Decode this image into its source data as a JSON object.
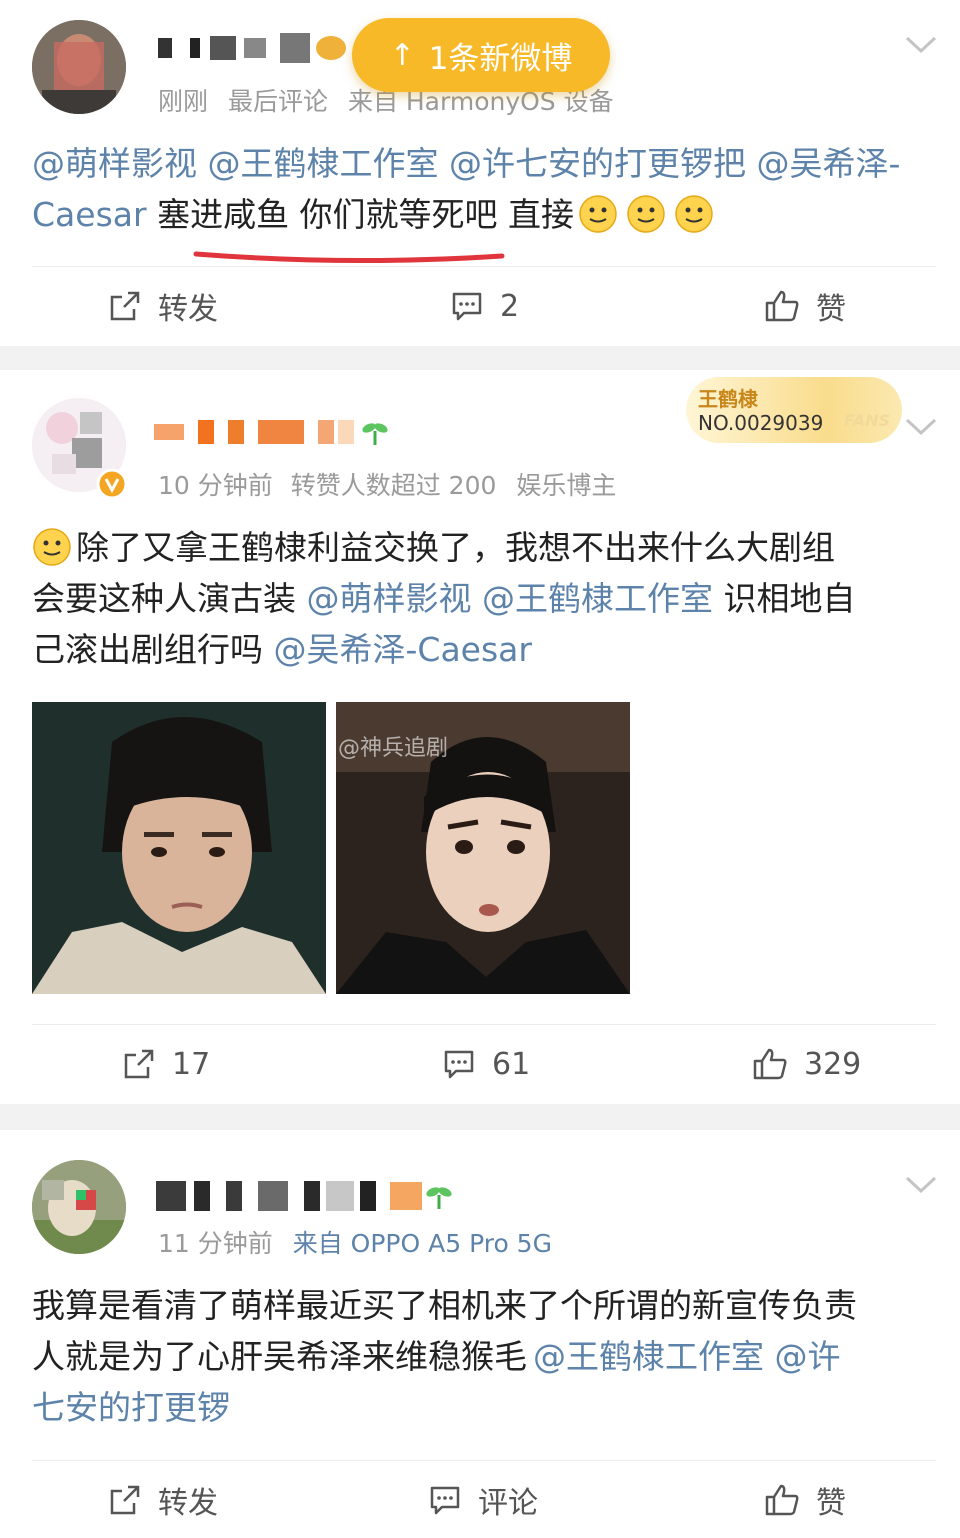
{
  "new_posts_pill": {
    "arrow": "↑",
    "label": "1条新微博"
  },
  "posts": [
    {
      "meta": {
        "time": "刚刚",
        "extra": "最后评论",
        "source": "来自 HarmonyOS 设备"
      },
      "content": {
        "mentions": [
          "@萌样影视",
          "@王鹤棣工作室",
          "@许七安的打更锣把",
          "@吴希泽-Caesar"
        ],
        "text": "塞进咸鱼 你们就等死吧 直接"
      },
      "actions": {
        "repost": "转发",
        "comment": "2",
        "like": "赞"
      }
    },
    {
      "meta": {
        "time": "10 分钟前",
        "extra": "转赞人数超过 200",
        "source": "娱乐博主"
      },
      "fans_badge": {
        "name": "王鹤棣",
        "number": "NO.0029039",
        "tag": "FANS"
      },
      "content": {
        "text1": "除了又拿王鹤棣利益交换了，我想不出来什么大剧组",
        "text2": "会要这种人演古装",
        "mention1": "@萌样影视",
        "mention2": "@王鹤棣工作室",
        "text3": "识相地自",
        "text4": "己滚出剧组行吗",
        "mention3": "@吴希泽-Caesar"
      },
      "image_watermark": "@神兵追剧",
      "actions": {
        "repost": "17",
        "comment": "61",
        "like": "329"
      }
    },
    {
      "meta": {
        "time": "11 分钟前",
        "source": "来自 OPPO A5 Pro 5G"
      },
      "content": {
        "line1": "我算是看清了萌样最近买了相机来了个所谓的新宣传负责",
        "line2": "人就是为了心肝吴希泽来维稳猴毛",
        "mention1": "@王鹤棣工作室",
        "mention2a": "@许",
        "mention2b": "七安的打更锣"
      },
      "actions": {
        "repost": "转发",
        "comment": "评论",
        "like": "赞"
      }
    }
  ]
}
